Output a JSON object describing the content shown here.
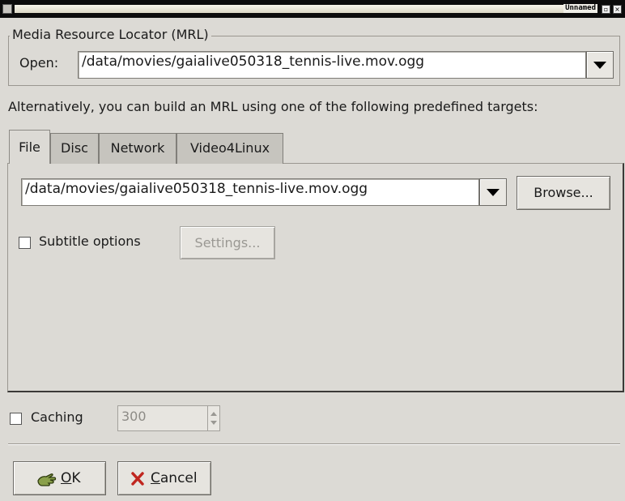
{
  "window": {
    "title": "Unnamed"
  },
  "mrl_group": {
    "legend": "Media Resource Locator (MRL)",
    "open_label": "Open:",
    "open_value": "/data/movies/gaialive050318_tennis-live.mov.ogg"
  },
  "alternative_text": "Alternatively, you can build an MRL using one of the following predefined targets:",
  "tabs": [
    {
      "label": "File",
      "active": true
    },
    {
      "label": "Disc",
      "active": false
    },
    {
      "label": "Network",
      "active": false
    },
    {
      "label": "Video4Linux",
      "active": false
    }
  ],
  "file_tab": {
    "path_value": "/data/movies/gaialive050318_tennis-live.mov.ogg",
    "browse_label": "Browse...",
    "subtitle_label": "Subtitle options",
    "subtitle_checked": false,
    "settings_label": "Settings..."
  },
  "caching": {
    "label": "Caching",
    "checked": false,
    "value": "300"
  },
  "buttons": {
    "ok_mnemonic": "O",
    "ok_rest": "K",
    "cancel_mnemonic": "C",
    "cancel_rest": "ancel"
  },
  "icons": {
    "ok": "hand-ok-icon",
    "cancel": "red-x-icon",
    "dropdown": "triangle-down-icon"
  },
  "colors": {
    "background": "#dcdad5",
    "titlebar": "#0c0c0c",
    "cancel_icon": "#c0261f",
    "ok_icon": "#5c7a1f"
  }
}
